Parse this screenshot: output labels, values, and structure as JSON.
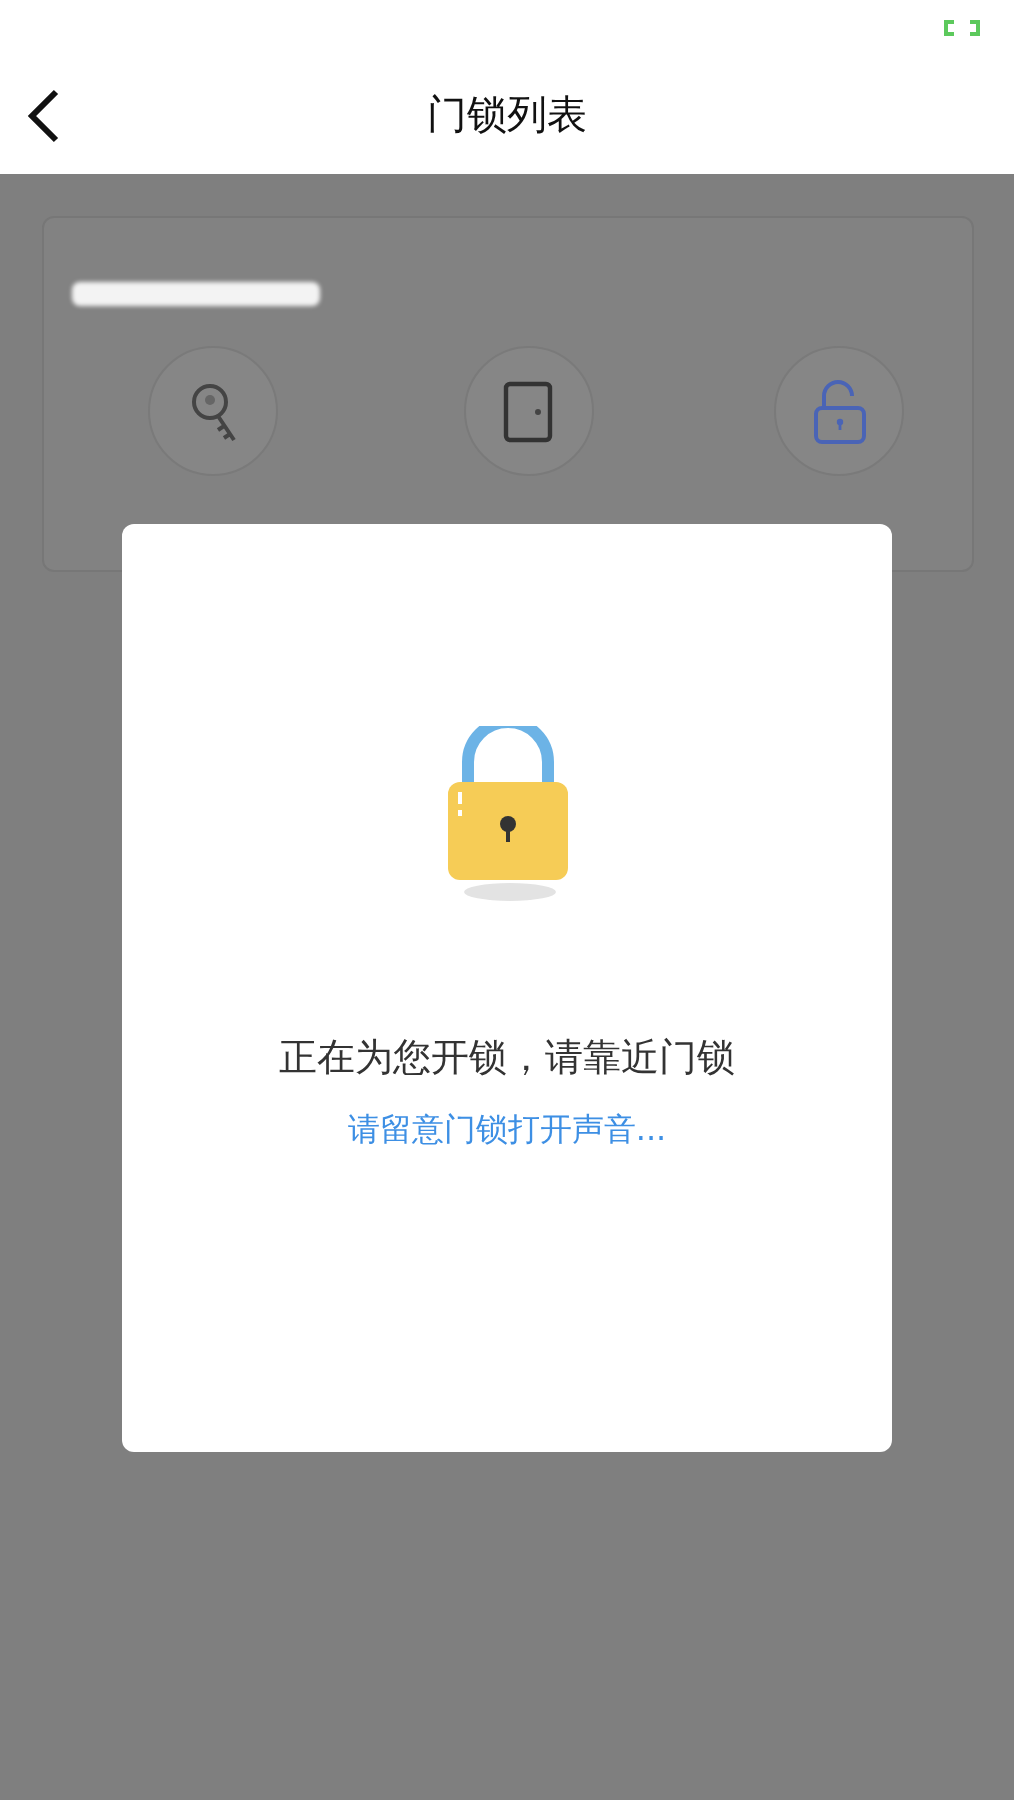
{
  "header": {
    "title": "门锁列表"
  },
  "lock_card": {
    "actions": [
      {
        "kind": "key"
      },
      {
        "kind": "door"
      },
      {
        "kind": "lock"
      }
    ]
  },
  "dialog": {
    "message": "正在为您开锁，请靠近门锁",
    "hint": "请留意门锁打开声音..."
  }
}
